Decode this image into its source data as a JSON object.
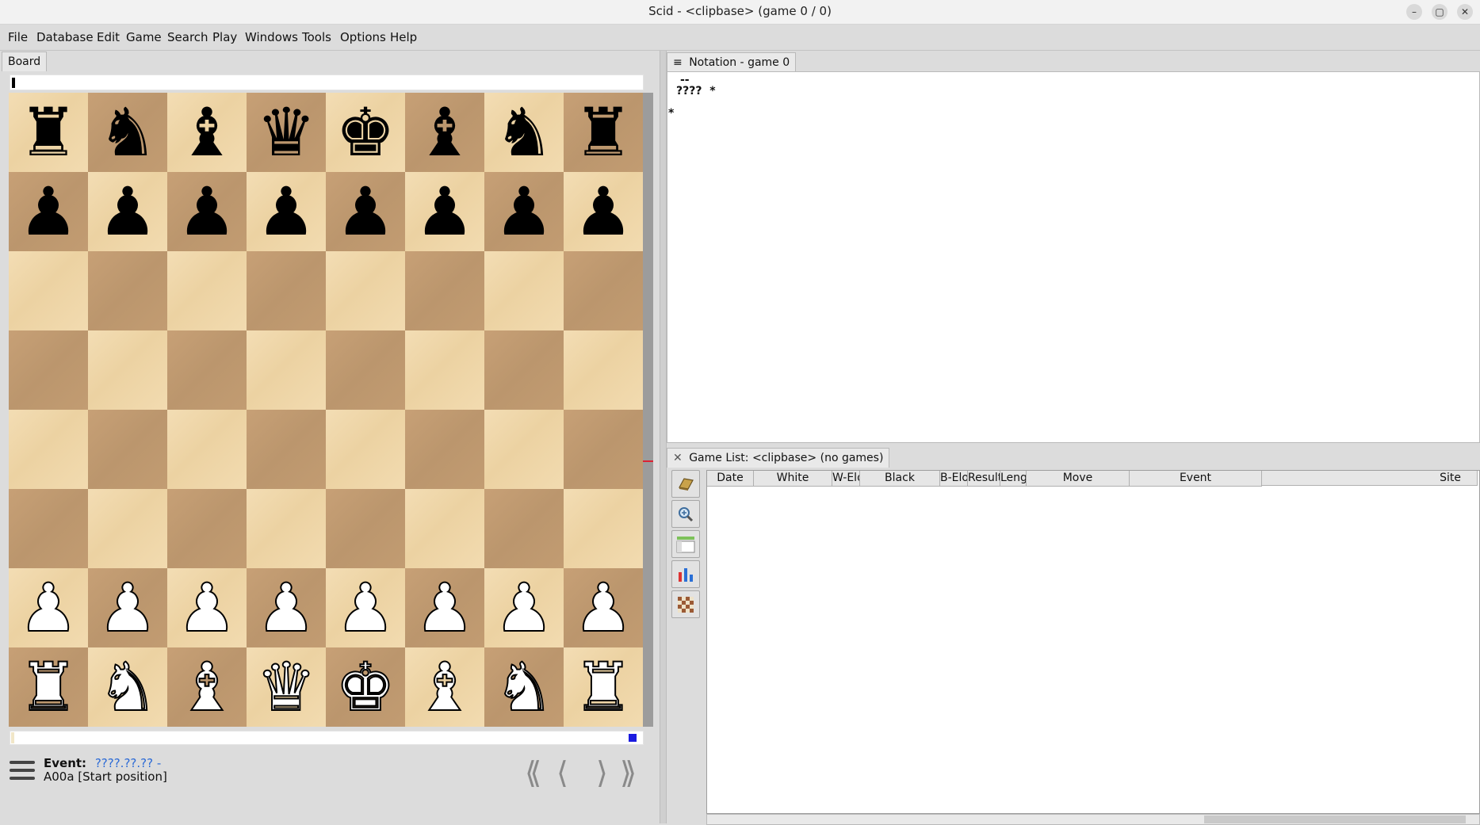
{
  "window": {
    "title": "Scid - <clipbase> (game 0 / 0)",
    "controls": [
      "–",
      "▢",
      "✕"
    ]
  },
  "menubar": [
    "File",
    "Database",
    "Edit",
    "Game",
    "Search",
    "Play",
    "Windows",
    "Tools",
    "Options",
    "Help"
  ],
  "board_panel": {
    "tab_label": "Board",
    "board": {
      "rank8": [
        "♜",
        "♞",
        "♝",
        "♛",
        "♚",
        "♝",
        "♞",
        "♜"
      ],
      "rank7": [
        "♟",
        "♟",
        "♟",
        "♟",
        "♟",
        "♟",
        "♟",
        "♟"
      ],
      "rank2": [
        "♟",
        "♟",
        "♟",
        "♟",
        "♟",
        "♟",
        "♟",
        "♟"
      ],
      "rank1": [
        "♜",
        "♞",
        "♝",
        "♛",
        "♚",
        "♝",
        "♞",
        "♜"
      ]
    },
    "info": {
      "event_label": "Event:",
      "event_value": "????.??.?? -",
      "opening": "A00a [Start position]"
    },
    "nav": {
      "first": "⟪",
      "prev": "⟨",
      "next": "⟩",
      "last": "⟫"
    }
  },
  "notation_panel": {
    "tab_label": "Notation - game 0",
    "tab_icon": "≡",
    "lines": [
      "--",
      "????  *",
      "*"
    ]
  },
  "gamelist_panel": {
    "tab_label": "Game List: <clipbase> (no games)",
    "tab_icon": "✕",
    "tools": [
      "book-icon",
      "zoom-icon",
      "layout-icon",
      "chart-icon",
      "board-icon"
    ],
    "columns": [
      "Date",
      "White",
      "W-Elo",
      "Black",
      "B-Elo",
      "Result",
      "Lengt",
      "Move",
      "Event",
      "Site"
    ]
  },
  "colors": {
    "light_square": "#f0d9ae",
    "dark_square": "#c19b70",
    "link_blue": "#2b6ad6"
  }
}
